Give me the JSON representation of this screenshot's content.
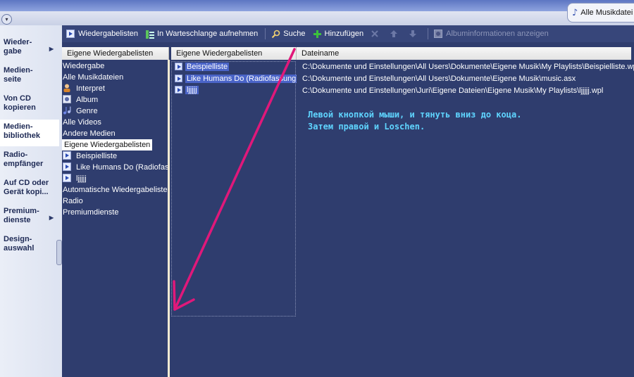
{
  "window": {
    "top_tab_label": "Alle Musikdatei"
  },
  "taskbar": {
    "items": [
      {
        "label": "Wieder-\ngabe",
        "has_arrow": true
      },
      {
        "label": "Medien-\nseite",
        "has_arrow": false
      },
      {
        "label": "Von CD\nkopieren",
        "has_arrow": false
      },
      {
        "label": "Medien-\nbibliothek",
        "has_arrow": false,
        "active": true
      },
      {
        "label": "Radio-\nempfänger",
        "has_arrow": false
      },
      {
        "label": "Auf CD oder\nGerät kopi...",
        "has_arrow": false
      },
      {
        "label": "Premium-\ndienste",
        "has_arrow": true
      },
      {
        "label": "Design-\nauswahl",
        "has_arrow": false
      }
    ]
  },
  "toolbar": {
    "playlists": "Wiedergabelisten",
    "queue": "In Warteschlange aufnehmen",
    "search": "Suche",
    "add": "Hinzufügen",
    "album_info": "Albuminformationen anzeigen"
  },
  "columns": {
    "tree": "Eigene Wiedergabelisten",
    "list": "Eigene Wiedergabelisten",
    "files": "Dateiname"
  },
  "tree": {
    "items": [
      "Wiedergabe",
      "Alle Musikdateien",
      "Interpret",
      "Album",
      "Genre",
      "Alle Videos",
      "Andere Medien",
      "Eigene Wiedergabelisten",
      "Beispielliste",
      "Like Humans Do (Radiofass",
      "ljjjjj",
      "Automatische Wiedergabelisten",
      "Radio",
      "Premiumdienste"
    ]
  },
  "list": {
    "items": [
      "Beispielliste",
      "Like Humans Do (Radiofassung)",
      "ljjjjj"
    ]
  },
  "files": {
    "rows": [
      "C:\\Dokumente und Einstellungen\\All Users\\Dokumente\\Eigene Musik\\My Playlists\\Beispielliste.wpl",
      "C:\\Dokumente und Einstellungen\\All Users\\Dokumente\\Eigene Musik\\music.asx",
      "C:\\Dokumente und Einstellungen\\Juri\\Eigene Dateien\\Eigene Musik\\My Playlists\\ljjjjj.wpl"
    ]
  },
  "annotation": {
    "line1": "Левой кнопкой мыши, и тянуть вниз до коца.",
    "line2": "Затем правой и Loschen.",
    "color": "#5fd4ff",
    "arrow_color": "#e0187a"
  }
}
